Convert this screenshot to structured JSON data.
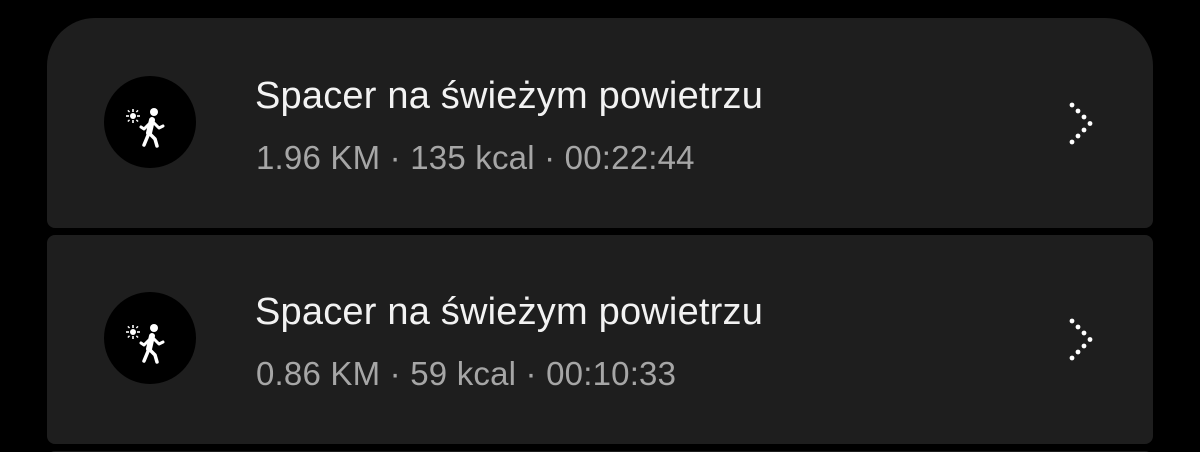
{
  "activities": [
    {
      "title": "Spacer na świeżym powietrzu",
      "details": "1.96 KM · 135 kcal · 00:22:44",
      "icon": "outdoor-walk-icon"
    },
    {
      "title": "Spacer na świeżym powietrzu",
      "details": "0.86 KM · 59 kcal · 00:10:33",
      "icon": "outdoor-walk-icon"
    }
  ],
  "colors": {
    "background": "#000000",
    "card": "#1e1e1e",
    "title": "#f2f2f2",
    "details": "#a6a6a6"
  }
}
